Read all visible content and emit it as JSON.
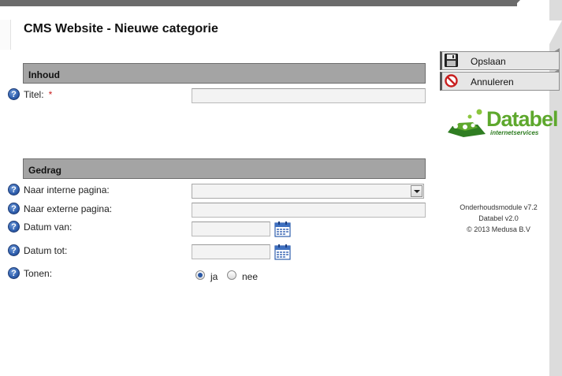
{
  "header": {
    "title": "CMS Website - Nieuwe categorie"
  },
  "sections": {
    "inhoud": {
      "title": "Inhoud"
    },
    "gedrag": {
      "title": "Gedrag"
    }
  },
  "fields": {
    "titel": {
      "label": "Titel:",
      "required_marker": "*",
      "value": ""
    },
    "naar_interne_pagina": {
      "label": "Naar interne pagina:",
      "selected": ""
    },
    "naar_externe_pagina": {
      "label": "Naar externe pagina:",
      "value": ""
    },
    "datum_van": {
      "label": "Datum van:",
      "value": ""
    },
    "datum_tot": {
      "label": "Datum tot:",
      "value": ""
    },
    "tonen": {
      "label": "Tonen:",
      "options": [
        {
          "label": "ja",
          "checked": true
        },
        {
          "label": "nee",
          "checked": false
        }
      ]
    }
  },
  "help_glyph": "?",
  "actions": {
    "save_label": "Opslaan",
    "cancel_label": "Annuleren"
  },
  "logo": {
    "name": "Databel",
    "tagline": "internetservices"
  },
  "footer": {
    "line1": "Onderhoudsmodule v7.2",
    "line2": "Databel v2.0",
    "line3": "© 2013 Medusa B.V"
  },
  "icons": {
    "help": "help-icon",
    "calendar": "calendar-icon",
    "save": "floppy-disk-icon",
    "cancel": "no-entry-icon"
  },
  "colors": {
    "section_header": "#a4a4a4",
    "logo_green": "#5ea82d",
    "required": "#c81e1e",
    "help_blue": "#2f5fae"
  }
}
